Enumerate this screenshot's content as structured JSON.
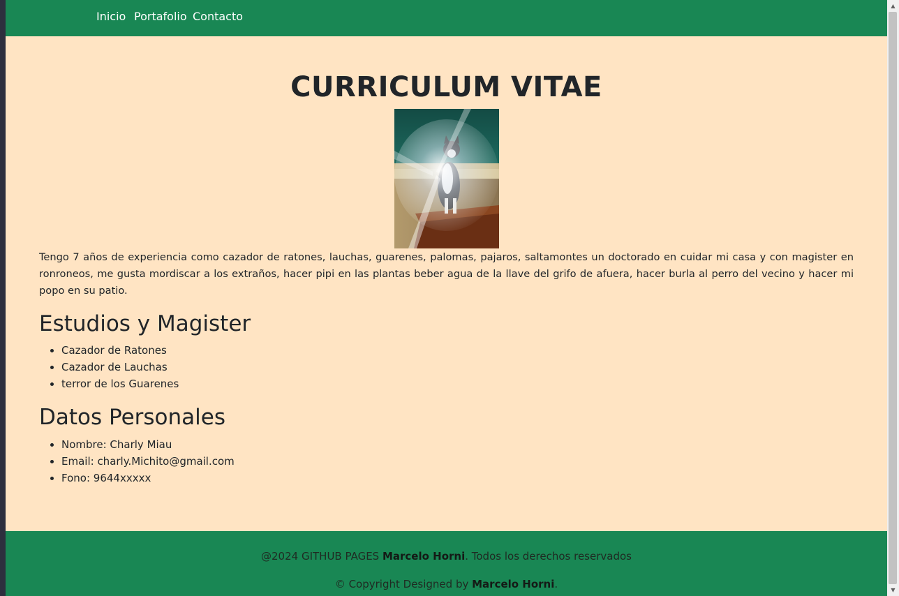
{
  "nav": {
    "items": [
      {
        "label": "Inicio"
      },
      {
        "label": "Portafolio"
      },
      {
        "label": "Contacto"
      }
    ]
  },
  "main": {
    "title": "CURRICULUM VITAE",
    "photo_alt": "cat-photo",
    "intro": "Tengo 7 años de experiencia como cazador de ratones, lauchas, guarenes, palomas, pajaros, saltamontes un doctorado en cuidar mi casa y con magister en ronroneos, me gusta mordiscar a los extraños, hacer pipi en las plantas beber agua de la llave del grifo de afuera, hacer burla al perro del vecino y hacer mi popo en su patio.",
    "studies": {
      "heading": "Estudios y Magister",
      "items": [
        "Cazador de Ratones",
        "Cazador de Lauchas",
        "terror de los Guarenes"
      ]
    },
    "personal": {
      "heading": "Datos Personales",
      "items": [
        "Nombre: Charly Miau",
        "Email: charly.Michito@gmail.com",
        "Fono: 9644xxxxx"
      ]
    }
  },
  "footer": {
    "line1_prefix": "@2024 GITHUB PAGES ",
    "line1_name": "Marcelo Horni",
    "line1_suffix": ". Todos los derechos reservados",
    "line2_prefix": "© Copyright Designed by ",
    "line2_name": "Marcelo Horni",
    "line2_suffix": "."
  },
  "colors": {
    "navbar": "#198754",
    "background": "#ffe4c3",
    "text": "#212529"
  }
}
